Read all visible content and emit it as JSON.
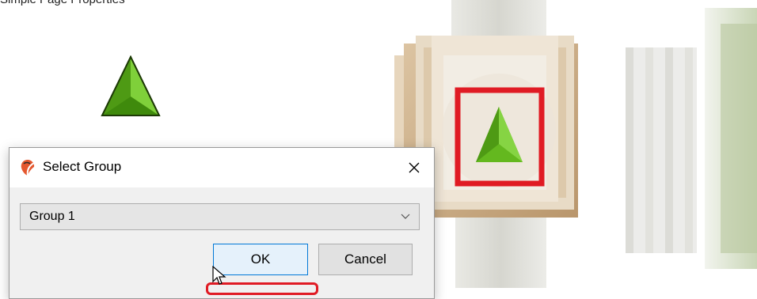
{
  "caption": "Simple Page Properties",
  "dialog": {
    "title": "Select Group",
    "close_glyph": "✕",
    "select_value": "Group 1",
    "ok_label": "OK",
    "cancel_label": "Cancel"
  },
  "icons": {
    "left": "green-pyramid-icon",
    "scene": "green-pyramid-marker-icon",
    "app": "app-logo-icon"
  },
  "colors": {
    "pyramid_green": "#5cb21c",
    "highlight_red": "#e01b24",
    "ok_border": "#0078d7"
  }
}
